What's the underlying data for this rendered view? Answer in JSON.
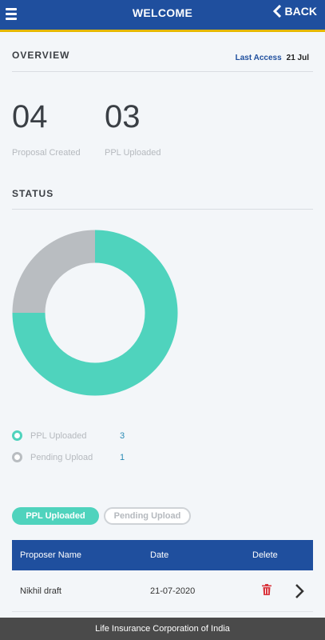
{
  "header": {
    "title": "WELCOME",
    "back_label": "BACK"
  },
  "overview": {
    "title": "OVERVIEW",
    "last_access_label": "Last Access",
    "last_access_value": "21 Jul",
    "stats": [
      {
        "number": "04",
        "label": "Proposal Created"
      },
      {
        "number": "03",
        "label": "PPL Uploaded"
      }
    ]
  },
  "status": {
    "title": "STATUS"
  },
  "chart_data": {
    "type": "pie",
    "categories": [
      "PPL Uploaded",
      "Pending Upload"
    ],
    "values": [
      3,
      1
    ],
    "colors": [
      "#4fd3bd",
      "#b9bdc1"
    ],
    "donut": true
  },
  "legend": [
    {
      "label": "PPL Uploaded",
      "value": "3",
      "color": "#4fd3bd"
    },
    {
      "label": "Pending Upload",
      "value": "1",
      "color": "#b9bdc1"
    }
  ],
  "tabs": {
    "active": "PPL Uploaded",
    "inactive": "Pending Upload"
  },
  "table": {
    "headers": [
      "Proposer Name",
      "Date",
      "Delete"
    ],
    "rows": [
      {
        "name": "Nikhil draft",
        "date": "21-07-2020"
      }
    ]
  },
  "footer": {
    "text": "Life Insurance Corporation of India"
  }
}
